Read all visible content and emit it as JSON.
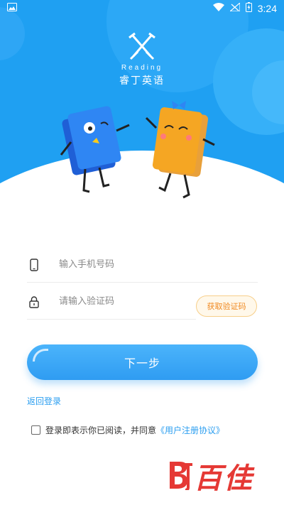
{
  "status_bar": {
    "time": "3:24",
    "icons": [
      "image-icon",
      "wifi-icon",
      "sim-no-signal-icon",
      "battery-charging-icon"
    ]
  },
  "logo": {
    "word": "Reading",
    "name": "睿丁英语"
  },
  "form": {
    "phone_placeholder": "输入手机号码",
    "code_placeholder": "请输入验证码",
    "get_code_label": "获取验证码",
    "next_label": "下一步",
    "back_login_label": "返回登录"
  },
  "agreement": {
    "text": "登录即表示你已阅读，并同意",
    "link": "《用户注册协议》",
    "checked": false
  },
  "watermark": {
    "text": "百佳"
  },
  "colors": {
    "brand_blue": "#1fa0f2",
    "link_blue": "#2b9ef0",
    "accent_orange": "#f08a22",
    "watermark_red": "#e53935"
  }
}
